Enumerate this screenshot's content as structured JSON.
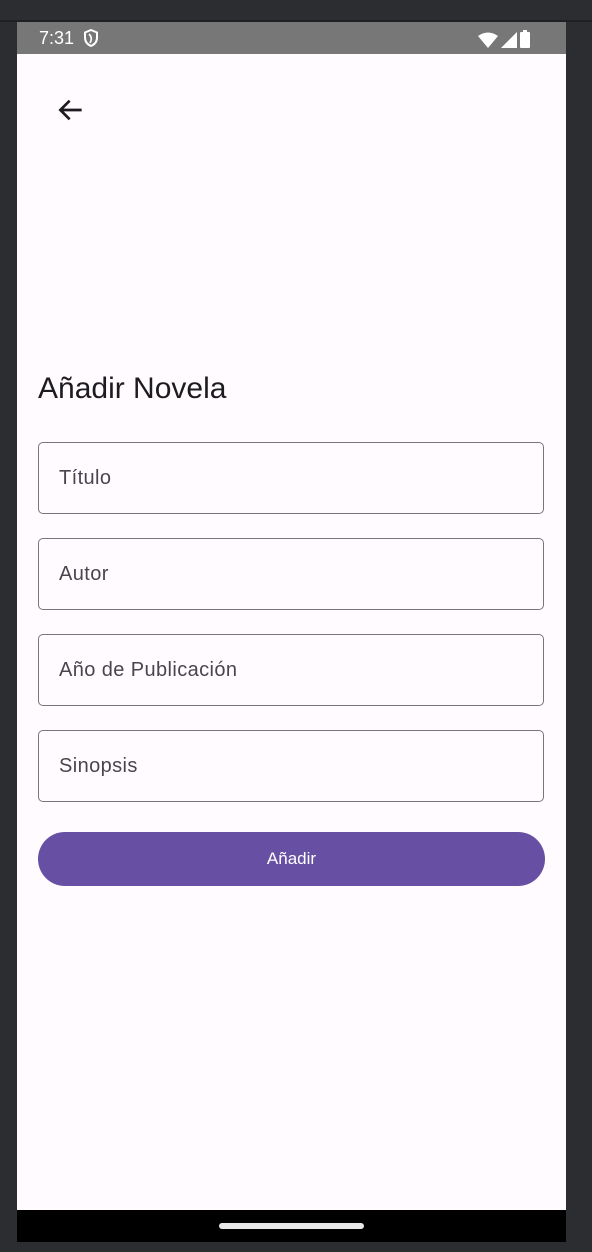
{
  "status_bar": {
    "time": "7:31",
    "icons": [
      "shield-icon",
      "wifi-icon",
      "signal-icon",
      "battery-icon"
    ]
  },
  "header": {
    "back_icon": "arrow-back-icon"
  },
  "page": {
    "title": "Añadir Novela"
  },
  "form": {
    "fields": [
      {
        "placeholder": "Título",
        "value": ""
      },
      {
        "placeholder": "Autor",
        "value": ""
      },
      {
        "placeholder": "Año de Publicación",
        "value": ""
      },
      {
        "placeholder": "Sinopsis",
        "value": ""
      }
    ],
    "submit_label": "Añadir"
  },
  "colors": {
    "primary": "#6750a4",
    "background": "#fffbfe",
    "outline": "#79747e",
    "status_bar": "#777777"
  }
}
